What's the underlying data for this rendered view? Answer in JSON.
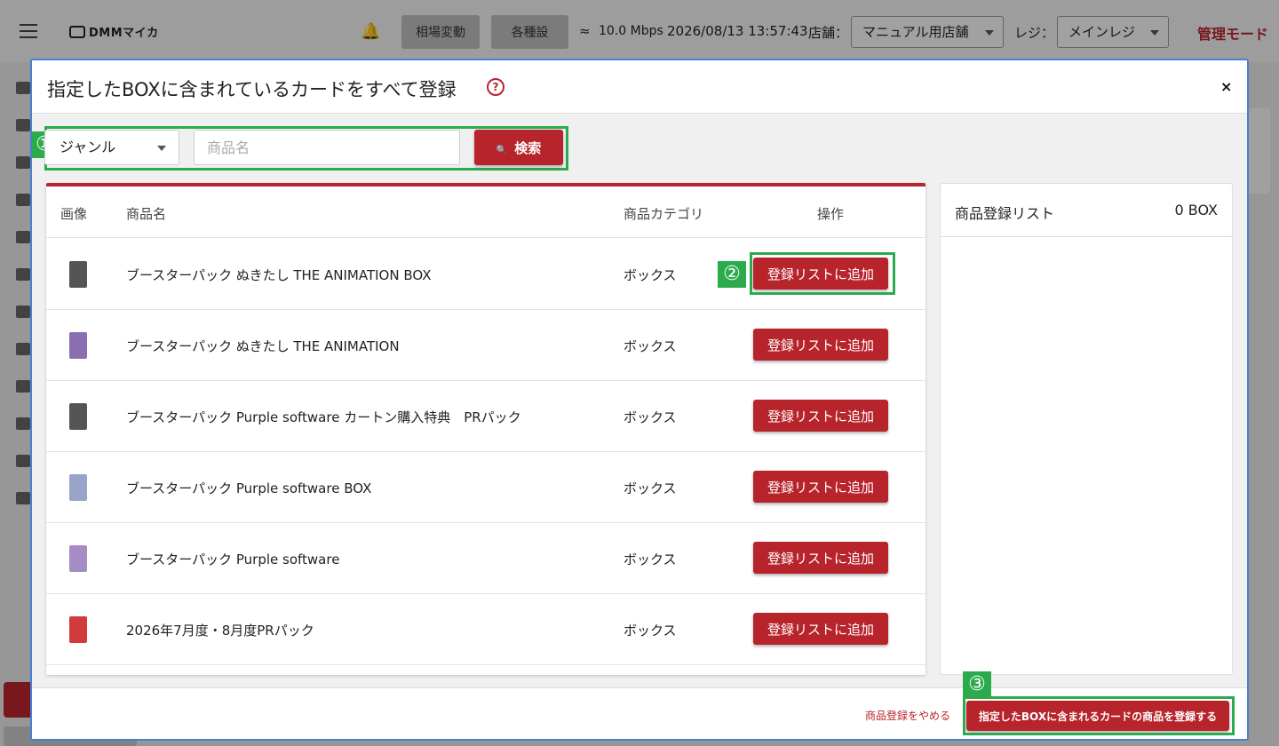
{
  "app_header": {
    "logo_text": "DMMマイカ",
    "btn_market": "相場変動",
    "btn_settings": "各種設定",
    "network": "10.0 Mbps",
    "datetime": "2026/08/13 13:57:43",
    "store_label": "店舗：",
    "store_value": "マニュアル用店舗",
    "register_label": "レジ：",
    "register_value": "メインレジ",
    "admin_mode": "管理モード"
  },
  "modal": {
    "title": "指定したBOXに含まれているカードをすべて登録",
    "help_symbol": "?",
    "close_symbol": "×",
    "badges": {
      "one": "①",
      "two": "②",
      "three": "③"
    },
    "search": {
      "genre_value": "ジャンル",
      "name_placeholder": "商品名",
      "search_label": "検索"
    },
    "table": {
      "headers": {
        "image": "画像",
        "name": "商品名",
        "category": "商品カテゴリ",
        "action": "操作"
      },
      "rows": [
        {
          "name": "ブースターパック ぬきたし THE ANIMATION BOX",
          "category": "ボックス",
          "action": "登録リストに追加",
          "thumb_color": "#555555"
        },
        {
          "name": "ブースターパック ぬきたし THE ANIMATION",
          "category": "ボックス",
          "action": "登録リストに追加",
          "thumb_color": "#8a6fb0"
        },
        {
          "name": "ブースターパック Purple software カートン購入特典　PRパック",
          "category": "ボックス",
          "action": "登録リストに追加",
          "thumb_color": "#555555"
        },
        {
          "name": "ブースターパック Purple software BOX",
          "category": "ボックス",
          "action": "登録リストに追加",
          "thumb_color": "#9aa3c8"
        },
        {
          "name": "ブースターパック Purple software",
          "category": "ボックス",
          "action": "登録リストに追加",
          "thumb_color": "#a58cc4"
        },
        {
          "name": "2026年7月度・8月度PRパック",
          "category": "ボックス",
          "action": "登録リストに追加",
          "thumb_color": "#d23b3b"
        }
      ]
    },
    "register_list": {
      "title": "商品登録リスト",
      "count": "0 BOX"
    },
    "footer": {
      "cancel_label": "商品登録をやめる",
      "submit_label": "指定したBOXに含まれるカードの商品を登録する"
    }
  },
  "colors": {
    "accent": "#b8242b",
    "highlight": "#2bab4b",
    "modal_border": "#4a7fd6"
  }
}
